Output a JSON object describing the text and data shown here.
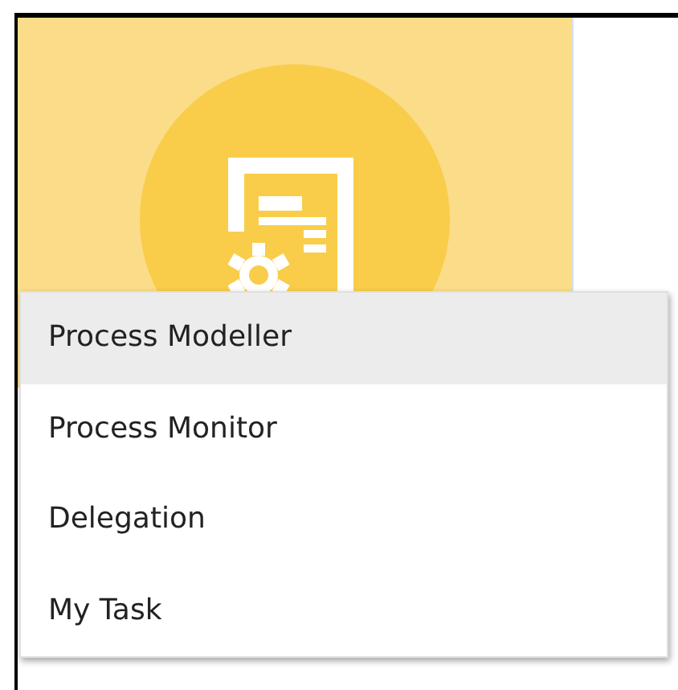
{
  "menu": {
    "items": [
      {
        "label": "Process Modeller",
        "selected": true
      },
      {
        "label": "Process Monitor",
        "selected": false
      },
      {
        "label": "Delegation",
        "selected": false
      },
      {
        "label": "My Task",
        "selected": false
      }
    ]
  }
}
